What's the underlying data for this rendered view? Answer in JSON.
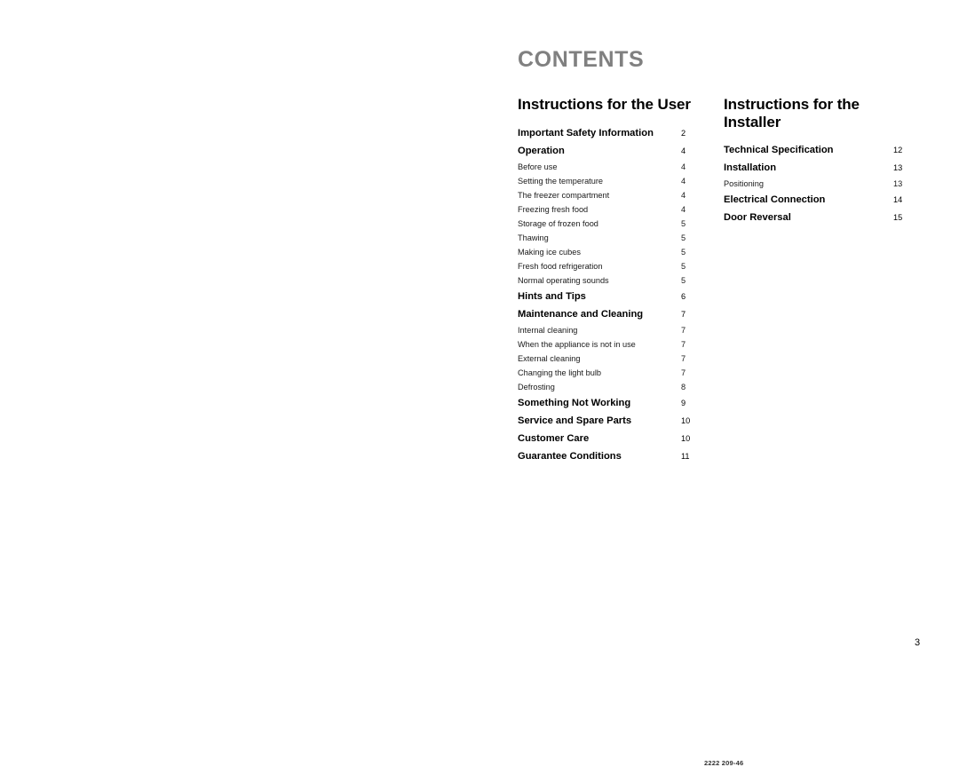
{
  "page": {
    "title": "CONTENTS",
    "title_color": "#808080",
    "background_color": "#ffffff",
    "page_number": "3",
    "document_code": "2222 209-46"
  },
  "columns": [
    {
      "id": "user",
      "heading": "Instructions for the User",
      "entries": [
        {
          "label": "Important Safety Information",
          "page": "2",
          "level": "major"
        },
        {
          "label": "Operation",
          "page": "4",
          "level": "major"
        },
        {
          "label": "Before use",
          "page": "4",
          "level": "sub"
        },
        {
          "label": "Setting the temperature",
          "page": "4",
          "level": "sub"
        },
        {
          "label": "The freezer compartment",
          "page": "4",
          "level": "sub"
        },
        {
          "label": "Freezing fresh food",
          "page": "4",
          "level": "sub"
        },
        {
          "label": "Storage of  frozen food",
          "page": "5",
          "level": "sub"
        },
        {
          "label": "Thawing",
          "page": "5",
          "level": "sub"
        },
        {
          "label": "Making ice cubes",
          "page": "5",
          "level": "sub"
        },
        {
          "label": "Fresh food refrigeration",
          "page": "5",
          "level": "sub"
        },
        {
          "label": "Normal operating sounds",
          "page": "5",
          "level": "sub"
        },
        {
          "label": "Hints and Tips",
          "page": "6",
          "level": "major"
        },
        {
          "label": "Maintenance and Cleaning",
          "page": "7",
          "level": "major"
        },
        {
          "label": "Internal cleaning",
          "page": "7",
          "level": "sub"
        },
        {
          "label": "When the appliance is not in use",
          "page": "7",
          "level": "sub"
        },
        {
          "label": "External cleaning",
          "page": "7",
          "level": "sub"
        },
        {
          "label": "Changing the light bulb",
          "page": "7",
          "level": "sub"
        },
        {
          "label": "Defrosting",
          "page": "8",
          "level": "sub"
        },
        {
          "label": "Something Not Working",
          "page": "9",
          "level": "major"
        },
        {
          "label": "Service and Spare Parts",
          "page": "10",
          "level": "major"
        },
        {
          "label": "Customer Care",
          "page": "10",
          "level": "major"
        },
        {
          "label": "Guarantee Conditions",
          "page": "11",
          "level": "major"
        }
      ]
    },
    {
      "id": "installer",
      "heading": "Instructions for the Installer",
      "entries": [
        {
          "label": "Technical Specification",
          "page": "12",
          "level": "major"
        },
        {
          "label": "Installation",
          "page": "13",
          "level": "major"
        },
        {
          "label": "Positioning",
          "page": "13",
          "level": "sub"
        },
        {
          "label": "Electrical Connection",
          "page": "14",
          "level": "major"
        },
        {
          "label": "Door Reversal",
          "page": "15",
          "level": "major"
        }
      ]
    }
  ]
}
